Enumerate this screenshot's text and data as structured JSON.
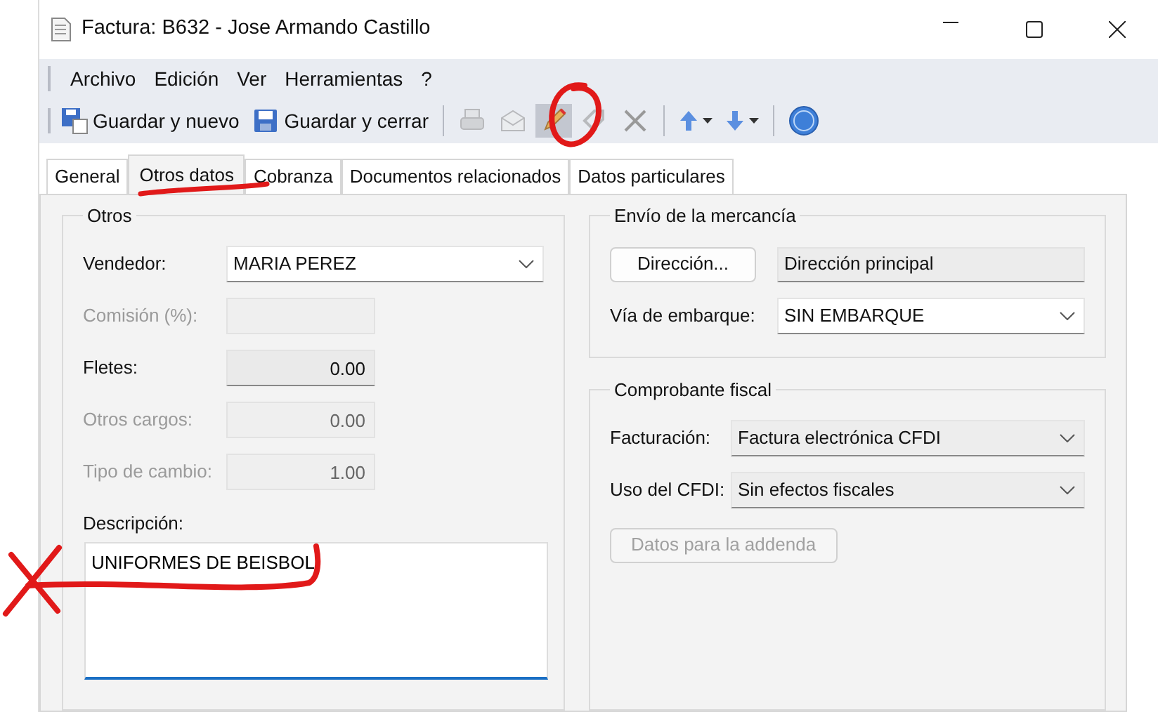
{
  "window": {
    "title": "Factura: B632 - Jose Armando Castillo"
  },
  "menu": [
    "Archivo",
    "Edición",
    "Ver",
    "Herramientas",
    "?"
  ],
  "toolbar": [
    {
      "kind": "button",
      "label": "Guardar y nuevo",
      "disabled": false
    },
    {
      "kind": "button",
      "label": "Guardar y cerrar",
      "disabled": false
    },
    {
      "kind": "separator"
    },
    {
      "kind": "icon",
      "disabled": true,
      "pressed": false
    },
    {
      "kind": "icon",
      "disabled": true,
      "pressed": false
    },
    {
      "kind": "icon",
      "disabled": false,
      "pressed": true
    },
    {
      "kind": "icon",
      "disabled": true,
      "pressed": false
    },
    {
      "kind": "icon",
      "disabled": true,
      "pressed": false
    },
    {
      "kind": "separator"
    },
    {
      "kind": "dropdown",
      "disabled": false
    },
    {
      "kind": "dropdown",
      "disabled": false
    },
    {
      "kind": "separator"
    },
    {
      "kind": "icon",
      "disabled": false,
      "pressed": false
    }
  ],
  "tabs": [
    {
      "label": "General",
      "selected": false
    },
    {
      "label": "Otros datos",
      "selected": true
    },
    {
      "label": "Cobranza",
      "selected": false
    },
    {
      "label": "Documentos relacionados",
      "selected": false
    },
    {
      "label": "Datos particulares",
      "selected": false
    }
  ],
  "otros": {
    "title": "Otros",
    "fields": [
      {
        "kind": "combo",
        "label": "Vendedor:",
        "value": "MARIA PEREZ",
        "disabled": false
      },
      {
        "kind": "input",
        "label": "Comisión (%):",
        "disabled": true
      },
      {
        "kind": "input",
        "label": "Fletes:",
        "value": "0.00",
        "disabled": false
      },
      {
        "kind": "input",
        "label": "Otros cargos:",
        "value": "0.00",
        "disabled": true
      },
      {
        "kind": "input",
        "label": "Tipo de cambio:",
        "value": "1.00",
        "disabled": true
      }
    ],
    "description": {
      "label": "Descripción:",
      "value": "UNIFORMES DE BEISBOL"
    }
  },
  "envio": {
    "title": "Envío de la mercancía",
    "address_button": "Dirección...",
    "address": "Dirección principal",
    "fields": [
      {
        "kind": "combo",
        "label": "Vía de embarque:",
        "value": "SIN EMBARQUE",
        "disabled": false
      }
    ]
  },
  "comprobante": {
    "title": "Comprobante fiscal",
    "fields": [
      {
        "kind": "combo",
        "label": "Facturación:",
        "value": "Factura electrónica CFDI",
        "disabled": false
      },
      {
        "kind": "combo",
        "label": "Uso del CFDI:",
        "value": "Sin efectos fiscales",
        "disabled": false
      }
    ],
    "addenda_button": {
      "label": "Datos para la addenda",
      "disabled": true
    }
  },
  "annotations": [
    {
      "kind": "circle"
    },
    {
      "kind": "underline"
    },
    {
      "kind": "underline"
    },
    {
      "kind": "cross"
    }
  ]
}
